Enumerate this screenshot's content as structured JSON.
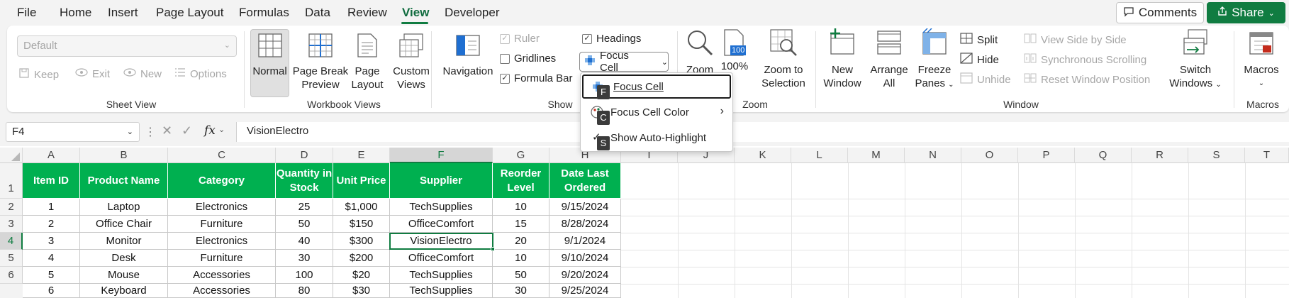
{
  "menu": {
    "items": [
      "File",
      "Home",
      "Insert",
      "Page Layout",
      "Formulas",
      "Data",
      "Review",
      "View",
      "Developer"
    ],
    "active": "View",
    "comments_label": "Comments",
    "share_label": "Share"
  },
  "ribbon": {
    "sheet_view": {
      "select_value": "Default",
      "keep": "Keep",
      "exit": "Exit",
      "new": "New",
      "options": "Options",
      "group_label": "Sheet View"
    },
    "workbook_views": {
      "normal": "Normal",
      "page_break_1": "Page Break",
      "page_break_2": "Preview",
      "page_layout_1": "Page",
      "page_layout_2": "Layout",
      "custom_views_1": "Custom",
      "custom_views_2": "Views",
      "group_label": "Workbook Views"
    },
    "show": {
      "navigation": "Navigation",
      "ruler": "Ruler",
      "gridlines": "Gridlines",
      "formula_bar": "Formula Bar",
      "headings": "Headings",
      "focus_cell": "Focus Cell",
      "group_label": "Show"
    },
    "zoom": {
      "zoom": "Zoom",
      "hundred": "100%",
      "zoom_sel_1": "Zoom to",
      "zoom_sel_2": "Selection",
      "group_label": "Zoom",
      "icon_text": "100"
    },
    "window": {
      "new_window_1": "New",
      "new_window_2": "Window",
      "arrange_1": "Arrange",
      "arrange_2": "All",
      "freeze_1": "Freeze",
      "freeze_2": "Panes",
      "split": "Split",
      "hide": "Hide",
      "unhide": "Unhide",
      "side_by_side": "View Side by Side",
      "sync_scroll": "Synchronous Scrolling",
      "reset_pos": "Reset Window Position",
      "switch_1": "Switch",
      "switch_2": "Windows",
      "group_label": "Window"
    },
    "macros": {
      "label": "Macros",
      "group_label": "Macros"
    }
  },
  "formula_bar": {
    "name_box": "F4",
    "fx": "fx",
    "value": "VisionElectro"
  },
  "dropdown": {
    "items": [
      {
        "label": "Focus Cell",
        "key": "F"
      },
      {
        "label": "Focus Cell Color",
        "key": "C"
      },
      {
        "label": "Show Auto-Highlight",
        "key": "S"
      }
    ]
  },
  "grid": {
    "columns": [
      "A",
      "B",
      "C",
      "D",
      "E",
      "F",
      "G",
      "H",
      "I",
      "J",
      "K",
      "L",
      "M",
      "N",
      "O",
      "P",
      "Q",
      "R",
      "S",
      "T"
    ],
    "rows": [
      "1",
      "2",
      "3",
      "4",
      "5",
      "6"
    ],
    "header": [
      "Item ID",
      "Product Name",
      "Category",
      "Quantity in Stock",
      "Unit Price",
      "Supplier",
      "Reorder Level",
      "Date Last Ordered"
    ],
    "data": [
      [
        "1",
        "Laptop",
        "Electronics",
        "25",
        "$1,000",
        "TechSupplies",
        "10",
        "9/15/2024"
      ],
      [
        "2",
        "Office Chair",
        "Furniture",
        "50",
        "$150",
        "OfficeComfort",
        "15",
        "8/28/2024"
      ],
      [
        "3",
        "Monitor",
        "Electronics",
        "40",
        "$300",
        "VisionElectro",
        "20",
        "9/1/2024"
      ],
      [
        "4",
        "Desk",
        "Furniture",
        "30",
        "$200",
        "OfficeComfort",
        "10",
        "9/10/2024"
      ],
      [
        "5",
        "Mouse",
        "Accessories",
        "100",
        "$20",
        "TechSupplies",
        "50",
        "9/20/2024"
      ],
      [
        "6",
        "Keyboard",
        "Accessories",
        "80",
        "$30",
        "TechSupplies",
        "30",
        "9/25/2024"
      ]
    ]
  },
  "colors": {
    "accent": "#107c41",
    "header_fill": "#00b050"
  }
}
